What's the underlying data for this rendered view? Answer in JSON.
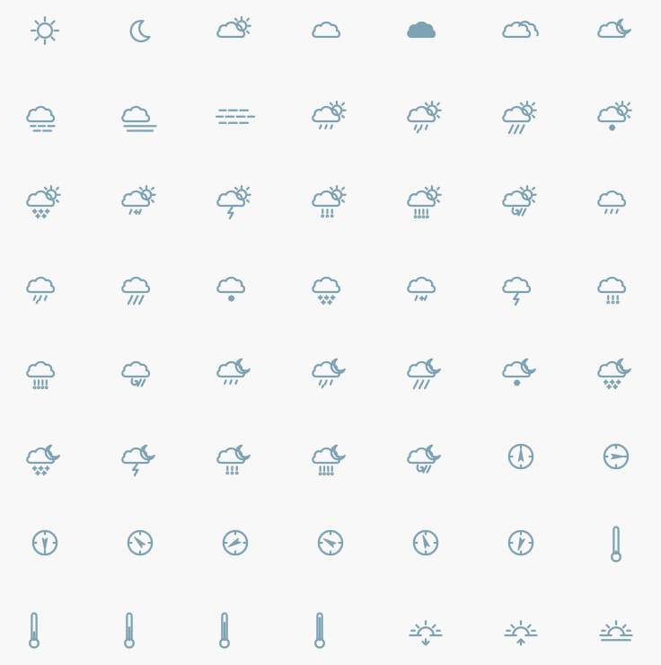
{
  "colors": {
    "background": "#f8f8f8",
    "icon": "#7da2b3"
  },
  "icon_grid": {
    "rows": [
      [
        "sun-icon",
        "moon-icon",
        "partly-cloudy-day-icon",
        "cloud-icon",
        "cloud-filled-icon",
        "clouds-icon",
        "partly-cloudy-night-icon"
      ],
      [
        "fog-icon",
        "mist-icon",
        "haze-icon",
        "rain-day-icon",
        "rain-heavy-day-icon",
        "rain-storm-day-icon",
        "snow-day-icon"
      ],
      [
        "snow-heavy-day-icon",
        "sleet-day-icon",
        "thunder-day-icon",
        "hail-day-icon",
        "hail-heavy-day-icon",
        "wind-rain-day-icon",
        "rain-icon"
      ],
      [
        "rain-heavy-icon",
        "rain-storm-icon",
        "snow-icon",
        "snow-heavy-icon",
        "sleet-icon",
        "thunder-icon",
        "hail-icon"
      ],
      [
        "hail-heavy-icon",
        "wind-rain-icon",
        "rain-night-icon",
        "rain-heavy-night-icon",
        "rain-storm-night-icon",
        "snow-night-icon",
        "snow-heavy-night-icon"
      ],
      [
        "sleet-night-icon",
        "thunder-night-icon",
        "hail-night-icon",
        "hail-heavy-night-icon",
        "wind-rain-night-icon",
        "compass-north-icon",
        "compass-east-icon"
      ],
      [
        "compass-south-icon",
        "compass-northwest-icon",
        "compass-southwest-icon",
        "compass-northwest-alt-icon",
        "compass-north-alt-icon",
        "compass-northeast-icon",
        "thermometer-low-icon"
      ],
      [
        "thermometer-mid-icon",
        "thermometer-high-icon",
        "thermometer-half-icon",
        "thermometer-full-icon",
        "sunset-icon",
        "sunrise-icon",
        "sun-horizon-icon"
      ]
    ]
  }
}
